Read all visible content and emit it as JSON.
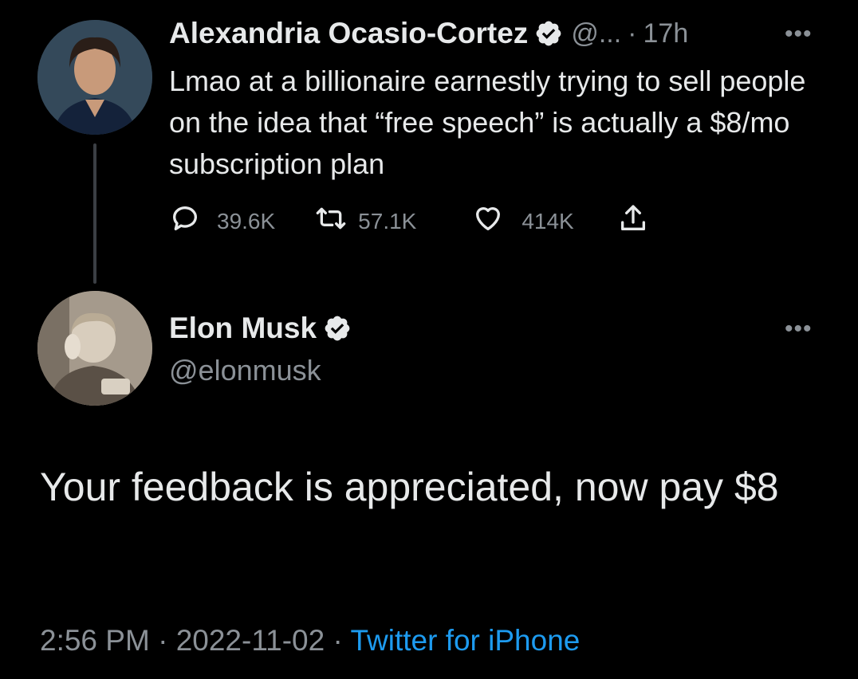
{
  "tweets": {
    "parent": {
      "author": "Alexandria Ocasio-Cortez",
      "handle_short": "@...",
      "separator": "·",
      "age": "17h",
      "text": "Lmao at a billionaire earnestly trying to sell people on the idea that “free speech” is actually a $8/mo subscription plan",
      "replies": "39.6K",
      "retweets": "57.1K",
      "likes": "414K",
      "more_icon": "•••"
    },
    "reply": {
      "author": "Elon Musk",
      "handle": "@elonmusk",
      "text": "Your feedback is appreciated, now pay $8",
      "more_icon": "•••",
      "time": "2:56 PM",
      "date": "2022-11-02",
      "sep": "·",
      "source": "Twitter for iPhone"
    }
  },
  "colors": {
    "background": "#000000",
    "text_primary": "#e7e9ea",
    "text_secondary": "#8b9197",
    "link": "#1d9bf0",
    "thread_line": "#3b3f44"
  },
  "icons": [
    "verified-badge-icon",
    "reply-icon",
    "retweet-icon",
    "like-icon",
    "share-icon",
    "more-icon"
  ]
}
